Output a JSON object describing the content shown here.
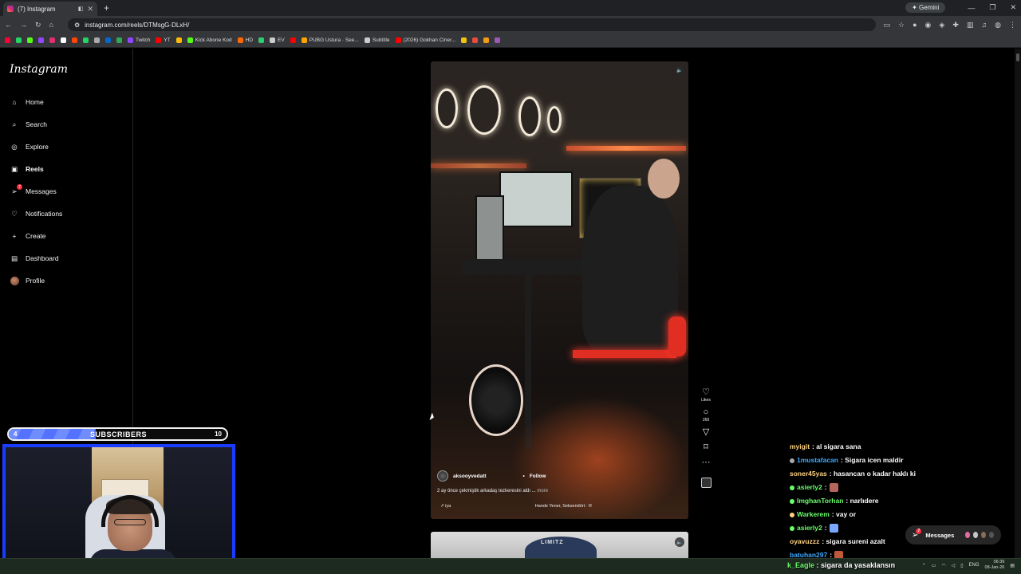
{
  "browser": {
    "tab_title": "(7) Instagram",
    "new_tab_symbol": "+",
    "gemini_label": "Gemini",
    "url": "instagram.com/reels/DTMsgG-DLxH/",
    "bookmarks": [
      {
        "label": "",
        "color": "#ff0033"
      },
      {
        "label": "",
        "color": "#25d366"
      },
      {
        "label": "",
        "color": "#53fc18"
      },
      {
        "label": "",
        "color": "#9146ff"
      },
      {
        "label": "",
        "color": "#e1306c"
      },
      {
        "label": "",
        "color": "#ffffff"
      },
      {
        "label": "",
        "color": "#ff4500"
      },
      {
        "label": "",
        "color": "#25d366"
      },
      {
        "label": "",
        "color": "#aaaaaa"
      },
      {
        "label": "",
        "color": "#0a66c2"
      },
      {
        "label": "",
        "color": "#34a853"
      },
      {
        "label": "Twitch",
        "color": "#9146ff"
      },
      {
        "label": "YT",
        "color": "#ff0000"
      },
      {
        "label": "",
        "color": "#fbbc05"
      },
      {
        "label": "Kick Abone Kod",
        "color": "#53fc18"
      },
      {
        "label": "HD",
        "color": "#ff6a00"
      },
      {
        "label": "",
        "color": "#2ecc71"
      },
      {
        "label": "EV",
        "color": "#cccccc"
      },
      {
        "label": "",
        "color": "#ff0000"
      },
      {
        "label": "PUBG Ustura · See...",
        "color": "#ffa500"
      },
      {
        "label": "Subtitle",
        "color": "#cccccc"
      },
      {
        "label": "(2026) Gokhan Ciner...",
        "color": "#ff0000"
      },
      {
        "label": "",
        "color": "#f1c40f"
      },
      {
        "label": "",
        "color": "#e74c3c"
      },
      {
        "label": "",
        "color": "#f39c12"
      },
      {
        "label": "",
        "color": "#9b59b6"
      }
    ]
  },
  "sidebar": {
    "logo": "Instagram",
    "items": [
      {
        "label": "Home",
        "icon": "home-icon",
        "glyph": "⌂"
      },
      {
        "label": "Search",
        "icon": "search-icon",
        "glyph": "⌕"
      },
      {
        "label": "Explore",
        "icon": "compass-icon",
        "glyph": "◎"
      },
      {
        "label": "Reels",
        "icon": "reels-icon",
        "glyph": "▣"
      },
      {
        "label": "Messages",
        "icon": "messages-icon",
        "glyph": "➢",
        "badge": "7"
      },
      {
        "label": "Notifications",
        "icon": "heart-icon",
        "glyph": "♡"
      },
      {
        "label": "Create",
        "icon": "plus-icon",
        "glyph": "+"
      },
      {
        "label": "Dashboard",
        "icon": "dashboard-icon",
        "glyph": "▤"
      },
      {
        "label": "Profile",
        "icon": "avatar",
        "glyph": ""
      }
    ]
  },
  "reel": {
    "author": "aksooyvedatt",
    "follow_separator": "•",
    "follow_label": "Follow",
    "caption": "2 ay önce çekmiştik arkadaş tezkeresini aldı ...",
    "caption_more": "more",
    "audio_left": "↗ iya",
    "audio_song": "Hande Yener, Seksendört · R",
    "mute_icon": "🔈",
    "actions": {
      "likes_label": "Likes",
      "comments_count": "269"
    },
    "next_reel_text": "LIMITZ"
  },
  "messages_pill": {
    "label": "Messages",
    "badge": "7"
  },
  "stream": {
    "subscribers_label": "SUBSCRIBERS",
    "subscribers_current": "4",
    "subscribers_goal": "10",
    "subscribers_progress": 0.4
  },
  "chat": [
    {
      "user": "myigit",
      "text": " : al sigara sana",
      "color": "#ffd27f",
      "badge": ""
    },
    {
      "user": "1mustafacan",
      "text": " : Sigara icen maldir",
      "color": "#3fa9ff",
      "badge": "#aaaaaa"
    },
    {
      "user": "soner45yas",
      "text": " : hasancan o kadar haklı ki",
      "color": "#ffd27f",
      "badge": ""
    },
    {
      "user": "asierly2",
      "text": " : ",
      "color": "#6cff6c",
      "badge": "#6cff6c",
      "emote": "#b5655b"
    },
    {
      "user": "ImghanTorhan",
      "text": " : narlıdere",
      "color": "#6cff6c",
      "badge": "#6cff6c"
    },
    {
      "user": "Warkerem",
      "text": " : vay or",
      "color": "#6cff6c",
      "badge": "#ffd27f"
    },
    {
      "user": "asierly2",
      "text": " : ",
      "color": "#6cff6c",
      "badge": "#6cff6c",
      "emote": "#7aa8ff"
    },
    {
      "user": "oyavuzzz",
      "text": " : sigara sureni azalt",
      "color": "#ffd27f",
      "badge": ""
    },
    {
      "user": "batuhan297",
      "text": " : ",
      "color": "#3fa9ff",
      "badge": "",
      "emote": "#c0583a"
    }
  ],
  "taskbar_chat": {
    "user": "k_Eagle",
    "text": " : sigara da yasaklansın",
    "color": "#6cff6c"
  },
  "tray": {
    "lang": "ENG",
    "time": "06:39",
    "date": "08-Jan-26"
  }
}
